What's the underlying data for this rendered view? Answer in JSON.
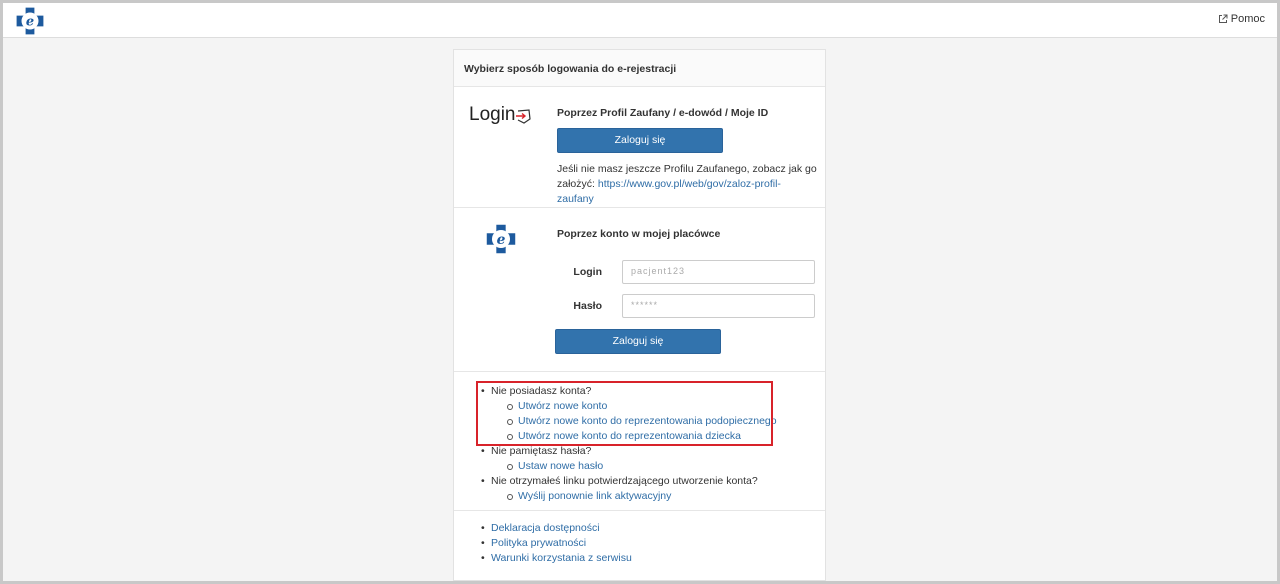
{
  "header": {
    "logo_icon": "e-rejestracja-logo-icon",
    "help_label": "Pomoc",
    "help_icon": "external-link-icon"
  },
  "panel": {
    "heading": "Wybierz sposób logowania do e-rejestracji",
    "profile": {
      "login_word": "Login",
      "login_icon": "login-arrow-shield-icon",
      "title": "Poprzez Profil Zaufany / e-dowód / Moje ID",
      "button": "Zaloguj się",
      "note_text": "Jeśli nie masz jeszcze Profilu Zaufanego, zobacz jak go założyć:",
      "note_link": "https://www.gov.pl/web/gov/zaloz-profil-zaufany"
    },
    "account": {
      "logo_icon": "e-rejestracja-logo-icon",
      "title": "Poprzez konto w mojej placówce",
      "login_label": "Login",
      "login_value": "pacjent123",
      "password_label": "Hasło",
      "password_value": "******",
      "button": "Zaloguj się"
    },
    "links": {
      "no_account": "Nie posiadasz konta?",
      "create_account": "Utwórz nowe konto",
      "create_ward": "Utwórz nowe konto do reprezentowania podopiecznego",
      "create_child": "Utwórz nowe konto do reprezentowania dziecka",
      "forgot_password": "Nie pamiętasz hasła?",
      "set_password": "Ustaw nowe hasło",
      "no_link": "Nie otrzymałeś linku potwierdzającego utworzenie konta?",
      "resend_link": "Wyślij ponownie link aktywacyjny"
    },
    "footer": {
      "accessibility": "Deklaracja dostępności",
      "privacy": "Polityka prywatności",
      "terms": "Warunki korzystania z serwisu"
    }
  },
  "colors": {
    "primary_button": "#3273ad",
    "link": "#2f6da6",
    "highlight_border": "#d8232a"
  }
}
